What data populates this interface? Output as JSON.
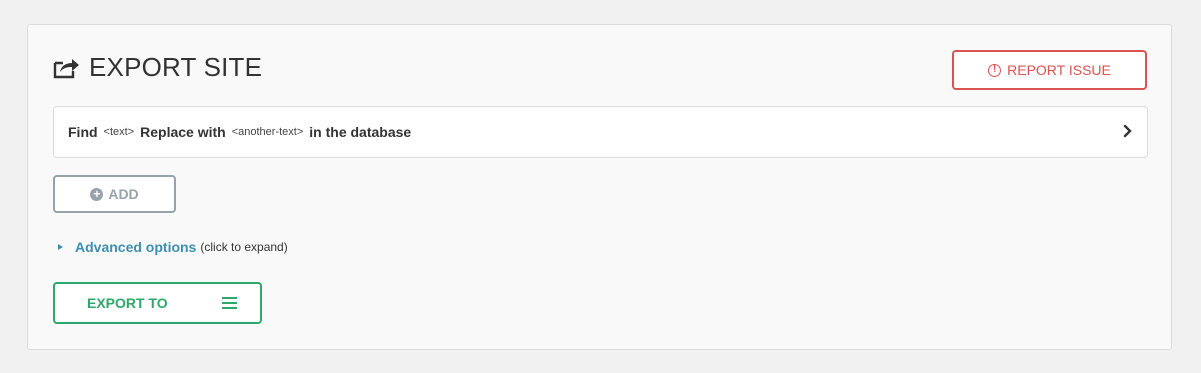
{
  "header": {
    "title": "EXPORT SITE",
    "title_icon": "share-icon",
    "report_button": "REPORT ISSUE",
    "report_icon": "exclamation-circle-icon"
  },
  "find_replace": {
    "find_label": "Find",
    "find_placeholder": "<text>",
    "replace_label": "Replace with",
    "replace_placeholder": "<another-text>",
    "suffix": "in the database",
    "chevron_icon": "chevron-right-icon"
  },
  "add_button": {
    "label": "ADD",
    "icon": "plus-circle-icon"
  },
  "advanced": {
    "link": "Advanced options",
    "hint": "(click to expand)"
  },
  "export_button": {
    "label": "EXPORT TO",
    "icon": "menu-icon"
  },
  "colors": {
    "report": "#d9534f",
    "add": "#97a3ab",
    "advanced": "#3c8fb2",
    "export": "#2ea86a"
  }
}
